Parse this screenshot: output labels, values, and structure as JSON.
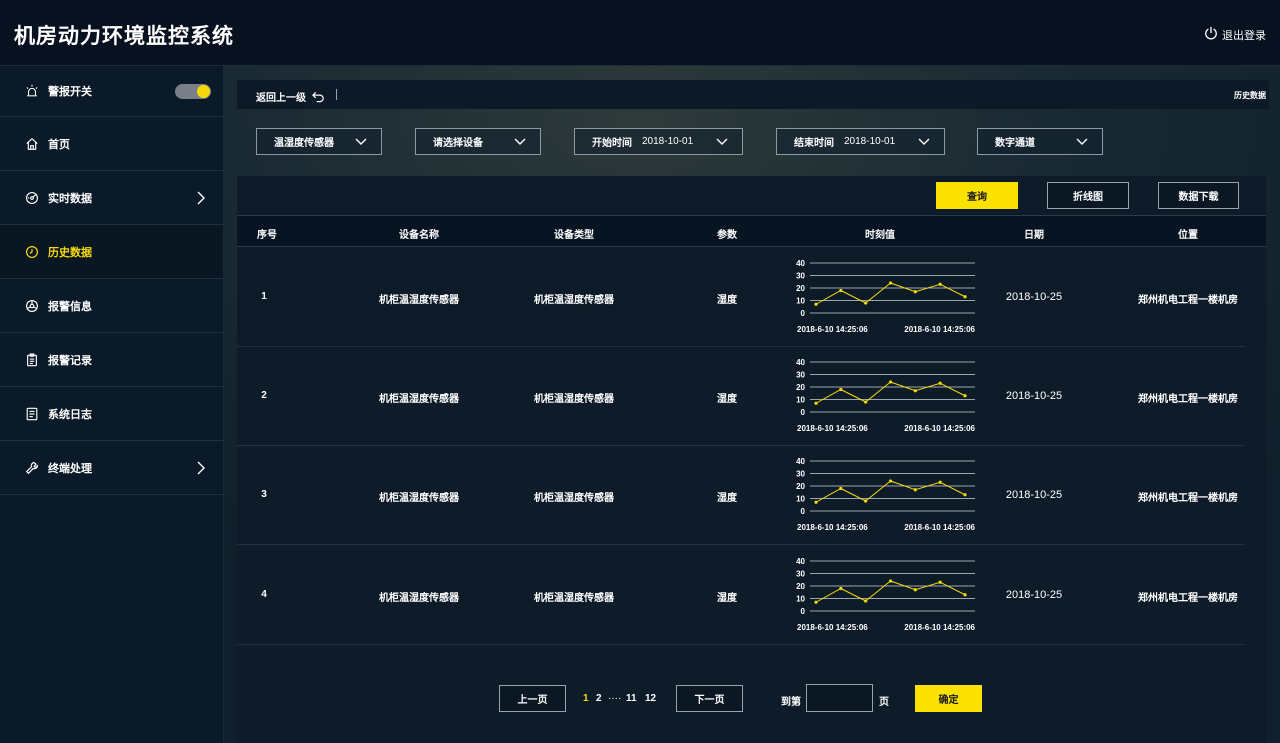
{
  "app": {
    "title": "机房动力环境监控系统",
    "logout_label": "退出登录"
  },
  "sidebar": {
    "items": [
      {
        "label": "警报开关",
        "icon": "alarm-light-icon"
      },
      {
        "label": "首页",
        "icon": "home-icon"
      },
      {
        "label": "实时数据",
        "icon": "dashboard-icon",
        "has_arrow": true
      },
      {
        "label": "历史数据",
        "icon": "clock-icon",
        "active": true
      },
      {
        "label": "报警信息",
        "icon": "alert-info-icon"
      },
      {
        "label": "报警记录",
        "icon": "clipboard-icon"
      },
      {
        "label": "系统日志",
        "icon": "log-icon"
      },
      {
        "label": "终端处理",
        "icon": "wrench-icon",
        "has_arrow": true
      }
    ],
    "alarm_toggle_on": true
  },
  "header": {
    "back_label": "返回上一级",
    "breadcrumb": "历史数据"
  },
  "filters": {
    "sensor_type": "温湿度传感器",
    "device": "请选择设备",
    "start_label": "开始时间",
    "start_date": "2018-10-01",
    "end_label": "结束时间",
    "end_date": "2018-10-01",
    "channel": "数字通道"
  },
  "actions": {
    "query": "查询",
    "line_chart": "折线图",
    "download": "数据下载"
  },
  "table": {
    "columns": [
      "序号",
      "设备名称",
      "设备类型",
      "参数",
      "时刻值",
      "日期",
      "位置"
    ],
    "rows": [
      {
        "index": "1",
        "device_name": "机柜温湿度传感器",
        "device_type": "机柜温湿度传感器",
        "param": "湿度",
        "date": "2018-10-25",
        "location": "郑州机电工程一楼机房"
      },
      {
        "index": "2",
        "device_name": "机柜温湿度传感器",
        "device_type": "机柜温湿度传感器",
        "param": "湿度",
        "date": "2018-10-25",
        "location": "郑州机电工程一楼机房"
      },
      {
        "index": "3",
        "device_name": "机柜温湿度传感器",
        "device_type": "机柜温湿度传感器",
        "param": "湿度",
        "date": "2018-10-25",
        "location": "郑州机电工程一楼机房"
      },
      {
        "index": "4",
        "device_name": "机柜温湿度传感器",
        "device_type": "机柜温湿度传感器",
        "param": "湿度",
        "date": "2018-10-25",
        "location": "郑州机电工程一楼机房"
      }
    ]
  },
  "chart_data": {
    "type": "line",
    "y_ticks": [
      "40",
      "30",
      "20",
      "10",
      "0"
    ],
    "ylim": [
      0,
      40
    ],
    "x_start_label": "2018-6-10  14:25:06",
    "x_end_label": "2018-6-10  14:25:06",
    "values": [
      7,
      18,
      8,
      24,
      17,
      23,
      13
    ],
    "line_color": "#f5d90a"
  },
  "pagination": {
    "prev": "上一页",
    "next": "下一页",
    "pages": [
      "1",
      "2",
      "····",
      "11",
      "12"
    ],
    "current": "1",
    "goto_prefix": "到第",
    "goto_suffix": "页",
    "confirm": "确定",
    "goto_value": ""
  },
  "colors": {
    "accent": "#f5d90a",
    "button_yellow": "#fae100"
  }
}
